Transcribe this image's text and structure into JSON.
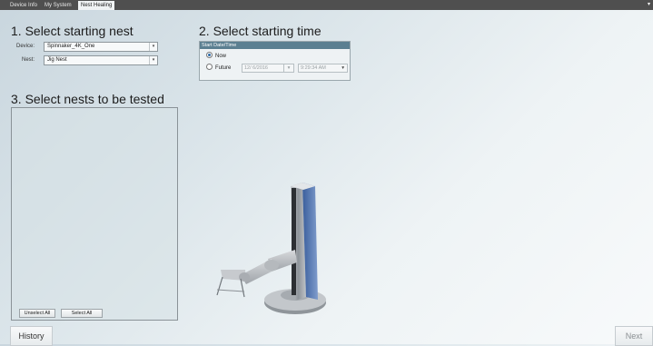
{
  "tabs": [
    {
      "label": "Device Info",
      "active": false
    },
    {
      "label": "My System",
      "active": false
    },
    {
      "label": "Nest Healing",
      "active": true
    }
  ],
  "section1": {
    "title": "1. Select starting nest",
    "device_label": "Device:",
    "device_value": "Spinnaker_4K_One",
    "nest_label": "Nest:",
    "nest_value": "Jig Nest"
  },
  "section2": {
    "title": "2. Select starting time",
    "group_header": "Start Date/Time",
    "now_label": "Now",
    "now_selected": true,
    "future_label": "Future",
    "future_selected": false,
    "date_value": "12/ 6/2016",
    "time_value": "9:29:34 AM"
  },
  "section3": {
    "title": "3. Select nests to be tested",
    "unselect_all_label": "Unselect All",
    "select_all_label": "Select All"
  },
  "footer": {
    "history_label": "History",
    "next_label": "Next"
  },
  "icons": {
    "dropdown": "chevron-down-icon",
    "calendar": "calendar-icon",
    "window_menu": "triangle-down-icon",
    "illustration": "robot-arm-image"
  },
  "colors": {
    "tabbar": "#4f4f4f",
    "group_header": "#5b7f91",
    "robot_accent": "#4d6fb0"
  }
}
